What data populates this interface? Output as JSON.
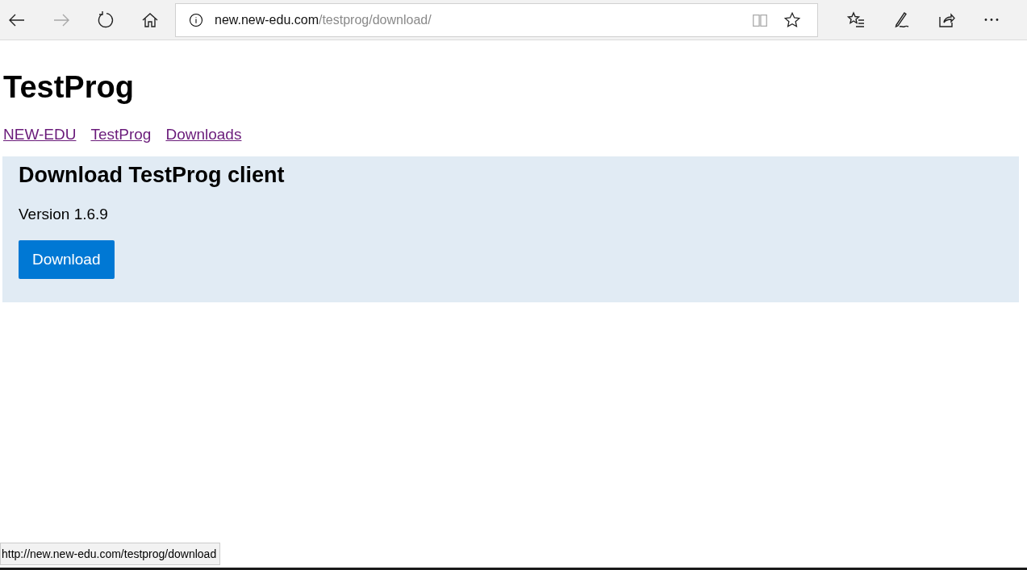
{
  "browser": {
    "back": {
      "disabled": false
    },
    "forward": {
      "disabled": true
    },
    "address": {
      "host": "new.new-edu.com",
      "path": "/testprog/download/"
    }
  },
  "page": {
    "title": "TestProg",
    "breadcrumbs": [
      "NEW-EDU",
      "TestProg",
      "Downloads"
    ],
    "panel": {
      "heading": "Download TestProg client",
      "version": "Version 1.6.9",
      "button": "Download"
    }
  },
  "status_url": "http://new.new-edu.com/testprog/download"
}
